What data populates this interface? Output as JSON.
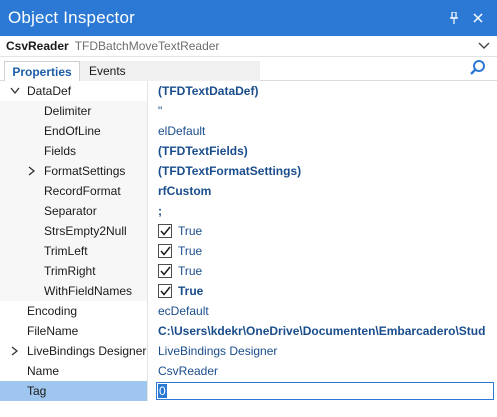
{
  "window": {
    "title": "Object Inspector"
  },
  "object": {
    "name": "CsvReader",
    "type": "TFDBatchMoveTextReader"
  },
  "tabs": [
    {
      "label": "Properties",
      "active": true
    },
    {
      "label": "Events",
      "active": false
    }
  ],
  "colors": {
    "accent": "#2b79d4",
    "selected_row": "#9fc6ef",
    "value_text": "#1a4d8c"
  },
  "properties": [
    {
      "name": "DataDef",
      "value": "(TFDTextDataDef)",
      "bold": true,
      "level": 0,
      "expander": "expanded"
    },
    {
      "name": "Delimiter",
      "value": "\"",
      "bold": false,
      "level": 1
    },
    {
      "name": "EndOfLine",
      "value": "elDefault",
      "bold": false,
      "level": 1
    },
    {
      "name": "Fields",
      "value": "(TFDTextFields)",
      "bold": true,
      "level": 1
    },
    {
      "name": "FormatSettings",
      "value": "(TFDTextFormatSettings)",
      "bold": true,
      "level": 1,
      "expander": "collapsed"
    },
    {
      "name": "RecordFormat",
      "value": "rfCustom",
      "bold": true,
      "level": 1
    },
    {
      "name": "Separator",
      "value": ";",
      "bold": true,
      "level": 1
    },
    {
      "name": "StrsEmpty2Null",
      "value": "True",
      "bold": false,
      "level": 1,
      "checkbox": true
    },
    {
      "name": "TrimLeft",
      "value": "True",
      "bold": false,
      "level": 1,
      "checkbox": true
    },
    {
      "name": "TrimRight",
      "value": "True",
      "bold": false,
      "level": 1,
      "checkbox": true
    },
    {
      "name": "WithFieldNames",
      "value": "True",
      "bold": true,
      "level": 1,
      "checkbox": true
    },
    {
      "name": "Encoding",
      "value": "ecDefault",
      "bold": false,
      "level": 0
    },
    {
      "name": "FileName",
      "value": "C:\\Users\\kdekr\\OneDrive\\Documenten\\Embarcadero\\Stud",
      "bold": true,
      "level": 0
    },
    {
      "name": "LiveBindings Designer",
      "value": "LiveBindings Designer",
      "bold": false,
      "level": 0,
      "expander": "collapsed"
    },
    {
      "name": "Name",
      "value": "CsvReader",
      "bold": false,
      "level": 0
    },
    {
      "name": "Tag",
      "value": "0",
      "bold": false,
      "level": 0,
      "selected": true
    }
  ]
}
